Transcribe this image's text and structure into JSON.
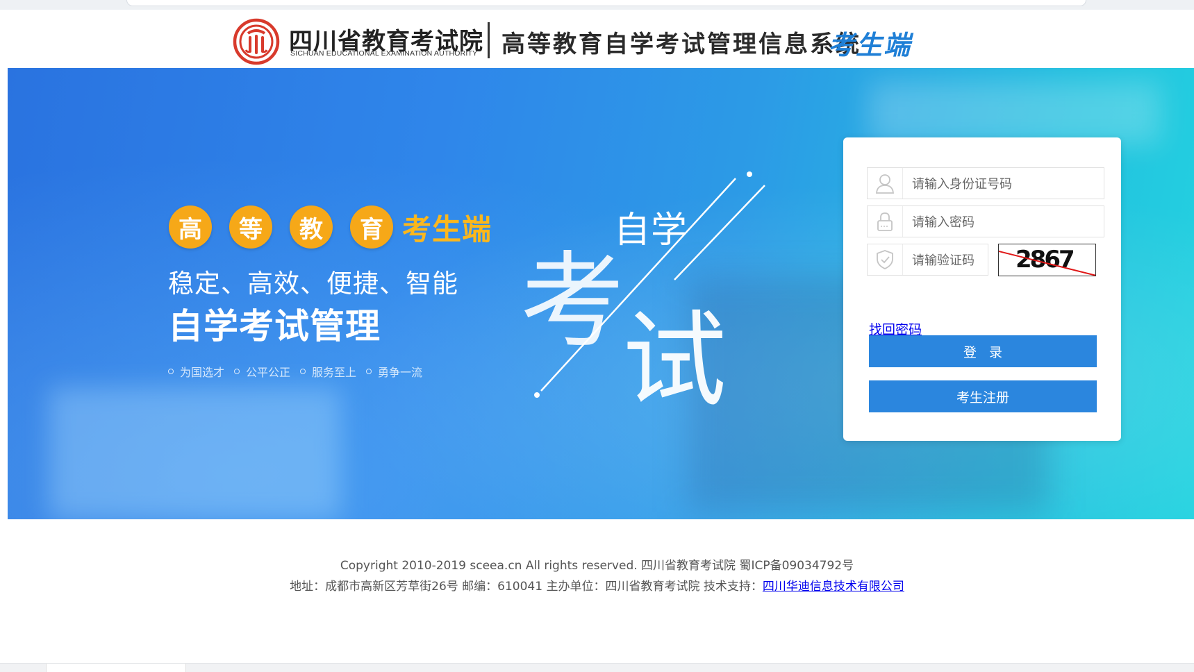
{
  "header": {
    "org_name_cn": "四川省教育考试院",
    "org_name_en": "SICHUAN EDUCATIONAL EXAMINATION AUTHORITY",
    "system_title": "高等教育自学考试管理信息系统",
    "system_tag": "考生端",
    "logo_icon": "sceea-emblem-icon",
    "brand_red": "#d83a2c",
    "accent_blue": "#1f7fd6"
  },
  "banner": {
    "badges": [
      "高",
      "等",
      "教",
      "育"
    ],
    "badge_tag": "考生端",
    "slogan": "稳定、高效、便捷、智能",
    "headline": "自学考试管理",
    "mottos": [
      "为国选才",
      "公平公正",
      "服务至上",
      "勇争一流"
    ],
    "art_small": "自学",
    "art_kao": "考",
    "art_shi": "试",
    "badge_color": "#f6a818"
  },
  "login": {
    "id_placeholder": "请输入身份证号码",
    "password_placeholder": "请输入密码",
    "captcha_placeholder": "请输验证码",
    "captcha_text": "2867",
    "forgot_password": "找回密码",
    "login_button": "登录",
    "register_button": "考生注册",
    "button_color": "#2b86de"
  },
  "footer": {
    "copyright": "Copyright 2010-2019 sceea.cn All rights reserved. 四川省教育考试院 蜀ICP备09034792号",
    "address": "地址：成都市高新区芳草街26号 邮编：610041 主办单位：四川省教育考试院 技术支持：",
    "tech_support_link": "四川华迪信息技术有限公司"
  }
}
